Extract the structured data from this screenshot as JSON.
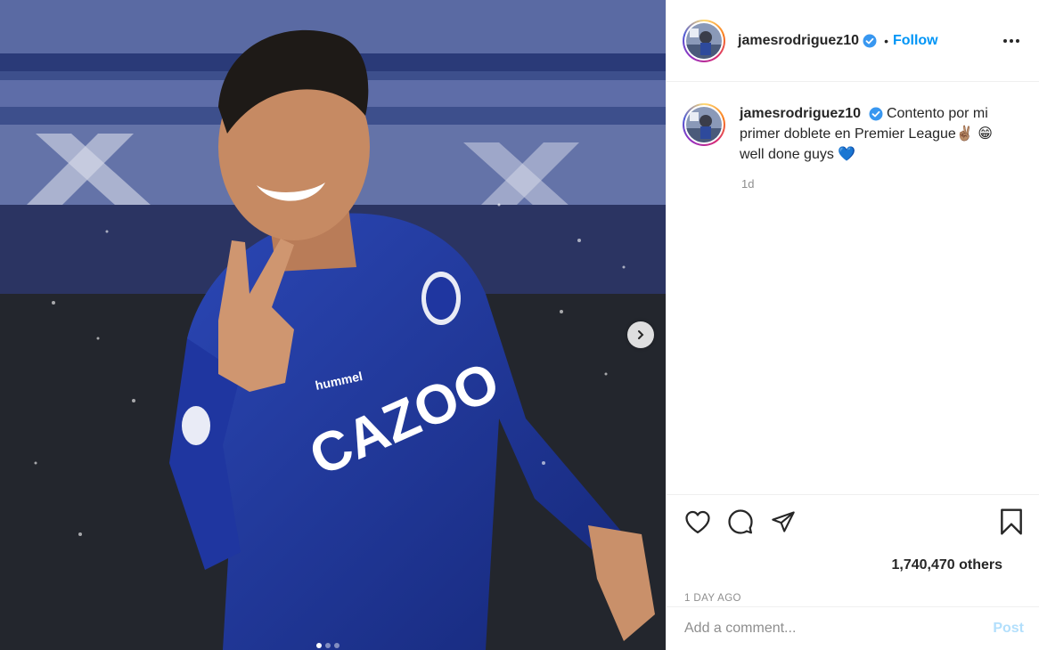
{
  "post": {
    "image_alt": "photo",
    "carousel_dots": 3,
    "active_dot": 0
  },
  "header": {
    "username": "jamesrodriguez10",
    "separator": "•",
    "follow_label": "Follow",
    "more_icon": "more-options-icon"
  },
  "caption": {
    "username": "jamesrodriguez10",
    "text_line1": "Contento por mi primer doblete en Premier League",
    "emoji_1": "✌🏽",
    "emoji_2": "😁",
    "text_line2": "well done guys",
    "emoji_3": "💙",
    "time": "1d"
  },
  "actions": {
    "like_icon": "heart-icon",
    "comment_icon": "comment-icon",
    "share_icon": "share-icon",
    "save_icon": "bookmark-icon"
  },
  "likes_text": "1,740,470 others",
  "timestamp": "1 DAY AGO",
  "comment": {
    "placeholder": "Add a comment...",
    "post_label": "Post"
  },
  "colors": {
    "accent": "#0095f6",
    "verified": "#3897f0",
    "post_disabled": "#b2dffc"
  }
}
